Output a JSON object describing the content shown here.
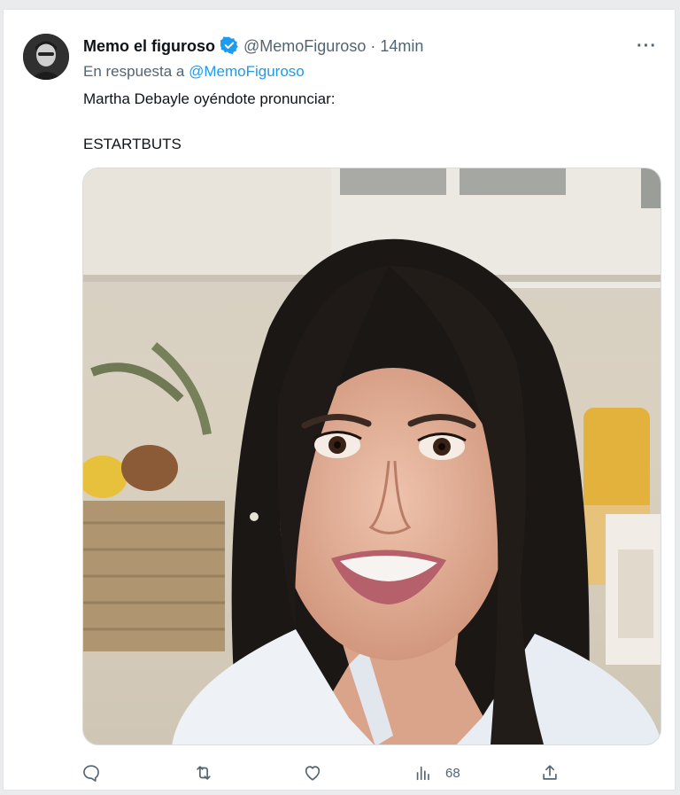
{
  "tweet": {
    "author_name": "Memo el figuroso",
    "handle": "@MemoFiguroso",
    "separator": "·",
    "time": "14min",
    "more_label": "···",
    "reply_prefix": "En respuesta a",
    "reply_handle": "@MemoFiguroso",
    "text_line1": "Martha Debayle oyéndote pronunciar:",
    "text_line2": "ESTARTBUTS"
  },
  "actions": {
    "reply_icon": "reply-icon",
    "retweet_icon": "retweet-icon",
    "like_icon": "heart-icon",
    "views_icon": "views-icon",
    "views_count": "68",
    "share_icon": "share-icon"
  },
  "colors": {
    "accent": "#1d9bf0",
    "text": "#0f1419",
    "muted": "#536471",
    "background": "#e9ebec"
  }
}
